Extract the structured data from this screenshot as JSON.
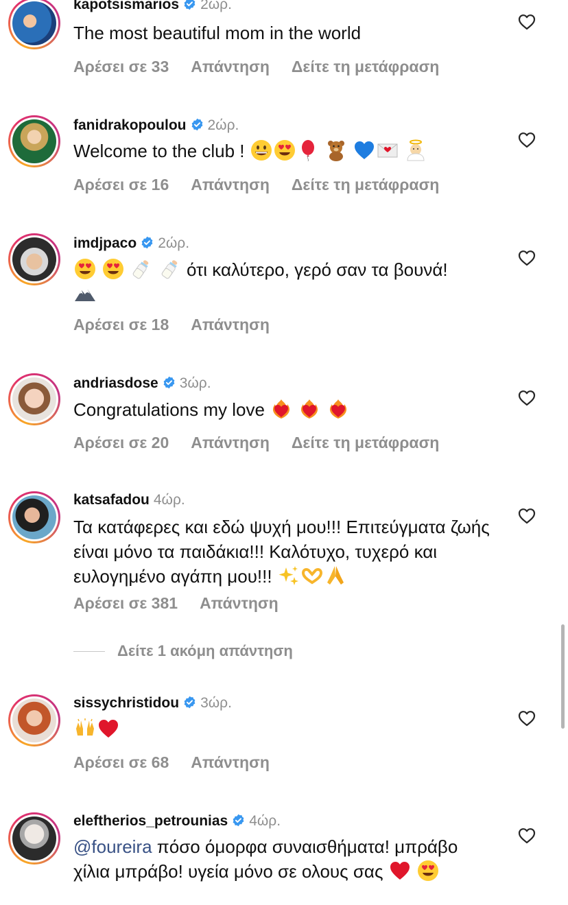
{
  "ui": {
    "reply_label": "Απάντηση",
    "translate_label": "Δείτε τη μετάφραση",
    "more_replies": "Δείτε 1 ακόμη απάντηση"
  },
  "colors": {
    "meta": "#8e8e8e",
    "mention": "#385185",
    "verified": "#3897f0"
  },
  "comments": [
    {
      "username": "kapotsismarios",
      "verified": true,
      "time": "2ώρ.",
      "text": "The most beautiful mom in the world",
      "likes": "Αρέσει σε 33",
      "has_translate": true
    },
    {
      "username": "fanidrakopoulou",
      "verified": true,
      "time": "2ώρ.",
      "text": "Welcome to the club !",
      "emoji": [
        "grinning-face",
        "heart-eyes",
        "balloon",
        "teddy-bear",
        "blue-heart",
        "love-letter",
        "baby-angel"
      ],
      "likes": "Αρέσει σε 16",
      "has_translate": true
    },
    {
      "username": "imdjpaco",
      "verified": true,
      "time": "2ώρ.",
      "text": "ότι καλύτερο, γερό σαν τα βουνά!",
      "emoji_before": [
        "heart-eyes",
        "heart-eyes",
        "baby-bottle",
        "baby-bottle"
      ],
      "emoji_after": [
        "mountain"
      ],
      "likes": "Αρέσει σε 18",
      "has_translate": false
    },
    {
      "username": "andriasdose",
      "verified": true,
      "time": "3ώρ.",
      "text": "Congratulations my love",
      "emoji": [
        "heart-on-fire",
        "heart-on-fire",
        "heart-on-fire"
      ],
      "likes": "Αρέσει σε 20",
      "has_translate": true
    },
    {
      "username": "katsafadou",
      "verified": false,
      "time": "4ώρ.",
      "text": "Τα κατάφερες και εδώ ψυχή μου!!! Επιτεύγματα ζωής είναι μόνο τα παιδάκια!!! Καλότυχο, τυχερό και ευλογημένο αγάπη μου!!!",
      "emoji": [
        "sparkles",
        "heart-hands",
        "folded-hands"
      ],
      "likes": "Αρέσει σε 381",
      "has_translate": false
    },
    {
      "username": "sissychristidou",
      "verified": true,
      "time": "3ώρ.",
      "text": "",
      "emoji": [
        "raising-hands",
        "red-heart"
      ],
      "likes": "Αρέσει σε 68",
      "has_translate": false
    },
    {
      "username": "eleftherios_petrounias",
      "verified": true,
      "time": "4ώρ.",
      "mention": "@foureira",
      "text": "πόσο όμορφα συναισθήματα! μπράβο χίλια μπράβο! υγεία μόνο σε ολους σας",
      "emoji": [
        "red-heart",
        "heart-eyes"
      ],
      "likes": "",
      "has_translate": false
    }
  ]
}
